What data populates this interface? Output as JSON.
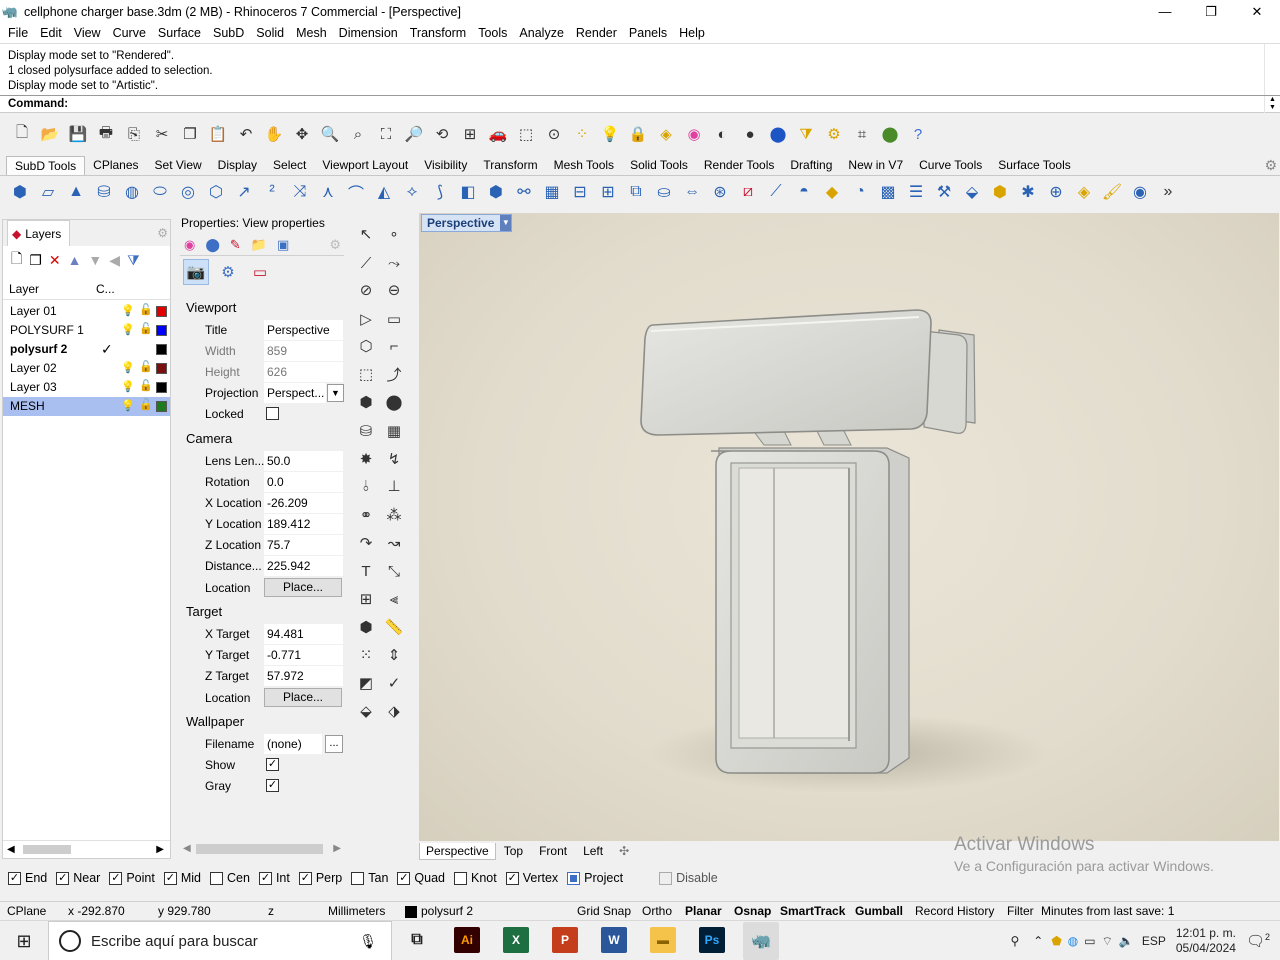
{
  "window": {
    "title": "cellphone charger base.3dm (2 MB) - Rhinoceros 7 Commercial - [Perspective]",
    "min": "—",
    "max": "❐",
    "close": "✕"
  },
  "menu": [
    "File",
    "Edit",
    "View",
    "Curve",
    "Surface",
    "SubD",
    "Solid",
    "Mesh",
    "Dimension",
    "Transform",
    "Tools",
    "Analyze",
    "Render",
    "Panels",
    "Help"
  ],
  "history": [
    "Display mode set to \"Rendered\".",
    "1 closed polysurface added to selection.",
    "Display mode set to \"Artistic\"."
  ],
  "command_label": "Command:",
  "toolbar_tabs": [
    "SubD Tools",
    "CPlanes",
    "Set View",
    "Display",
    "Select",
    "Viewport Layout",
    "Visibility",
    "Transform",
    "Mesh Tools",
    "Solid Tools",
    "Render Tools",
    "Drafting",
    "New in V7",
    "Curve Tools",
    "Surface Tools"
  ],
  "layers": {
    "tab_label": "Layers",
    "col_layer": "Layer",
    "col_c": "C...",
    "rows": [
      {
        "name": "Layer 01",
        "color": "#e00000",
        "current": false,
        "selected": false
      },
      {
        "name": "POLYSURF 1",
        "color": "#0000ff",
        "current": false,
        "selected": false
      },
      {
        "name": "polysurf 2",
        "color": "#000000",
        "current": true,
        "selected": false
      },
      {
        "name": "Layer 02",
        "color": "#7a1010",
        "current": false,
        "selected": false
      },
      {
        "name": "Layer 03",
        "color": "#000000",
        "current": false,
        "selected": false
      },
      {
        "name": "MESH",
        "color": "#1f7a1f",
        "current": false,
        "selected": true
      }
    ]
  },
  "props": {
    "title": "Properties: View properties",
    "viewport_h": "Viewport",
    "title_k": "Title",
    "title_v": "Perspective",
    "width_k": "Width",
    "width_v": "859",
    "height_k": "Height",
    "height_v": "626",
    "proj_k": "Projection",
    "proj_v": "Perspect...",
    "locked_k": "Locked",
    "camera_h": "Camera",
    "lens_k": "Lens Len...",
    "lens_v": "50.0",
    "rot_k": "Rotation",
    "rot_v": "0.0",
    "xl_k": "X Location",
    "xl_v": "-26.209",
    "yl_k": "Y Location",
    "yl_v": "189.412",
    "zl_k": "Z Location",
    "zl_v": "75.7",
    "dist_k": "Distance...",
    "dist_v": "225.942",
    "loc_k": "Location",
    "place": "Place...",
    "target_h": "Target",
    "xt_k": "X Target",
    "xt_v": "94.481",
    "yt_k": "Y Target",
    "yt_v": "-0.771",
    "zt_k": "Z Target",
    "zt_v": "57.972",
    "loc2_k": "Location",
    "wall_h": "Wallpaper",
    "file_k": "Filename",
    "file_v": "(none)",
    "file_btn": "...",
    "show_k": "Show",
    "gray_k": "Gray"
  },
  "viewport": {
    "label": "Perspective",
    "tabs": [
      "Perspective",
      "Top",
      "Front",
      "Left"
    ]
  },
  "watermark": {
    "line1": "Activar Windows",
    "line2": "Ve a Configuración para activar Windows."
  },
  "osnap": [
    {
      "label": "End",
      "checked": true
    },
    {
      "label": "Near",
      "checked": true
    },
    {
      "label": "Point",
      "checked": true
    },
    {
      "label": "Mid",
      "checked": true
    },
    {
      "label": "Cen",
      "checked": false
    },
    {
      "label": "Int",
      "checked": true
    },
    {
      "label": "Perp",
      "checked": true
    },
    {
      "label": "Tan",
      "checked": false
    },
    {
      "label": "Quad",
      "checked": true
    },
    {
      "label": "Knot",
      "checked": false
    },
    {
      "label": "Vertex",
      "checked": true
    },
    {
      "label": "Project",
      "checked": false
    },
    {
      "label": "Disable",
      "checked": false
    }
  ],
  "status": {
    "cplane": "CPlane",
    "x": "x -292.870",
    "y": "y 929.780",
    "z": "z",
    "units": "Millimeters",
    "layer": "polysurf 2",
    "grid": "Grid Snap",
    "ortho": "Ortho",
    "planar": "Planar",
    "osnap": "Osnap",
    "smarttrack": "SmartTrack",
    "gumball": "Gumball",
    "record": "Record History",
    "filter": "Filter",
    "save": "Minutes from last save: 1"
  },
  "taskbar": {
    "search": "Escribe aquí para buscar",
    "lang": "ESP",
    "time": "12:01 p. m.",
    "date": "05/04/2024",
    "notif": "2"
  }
}
